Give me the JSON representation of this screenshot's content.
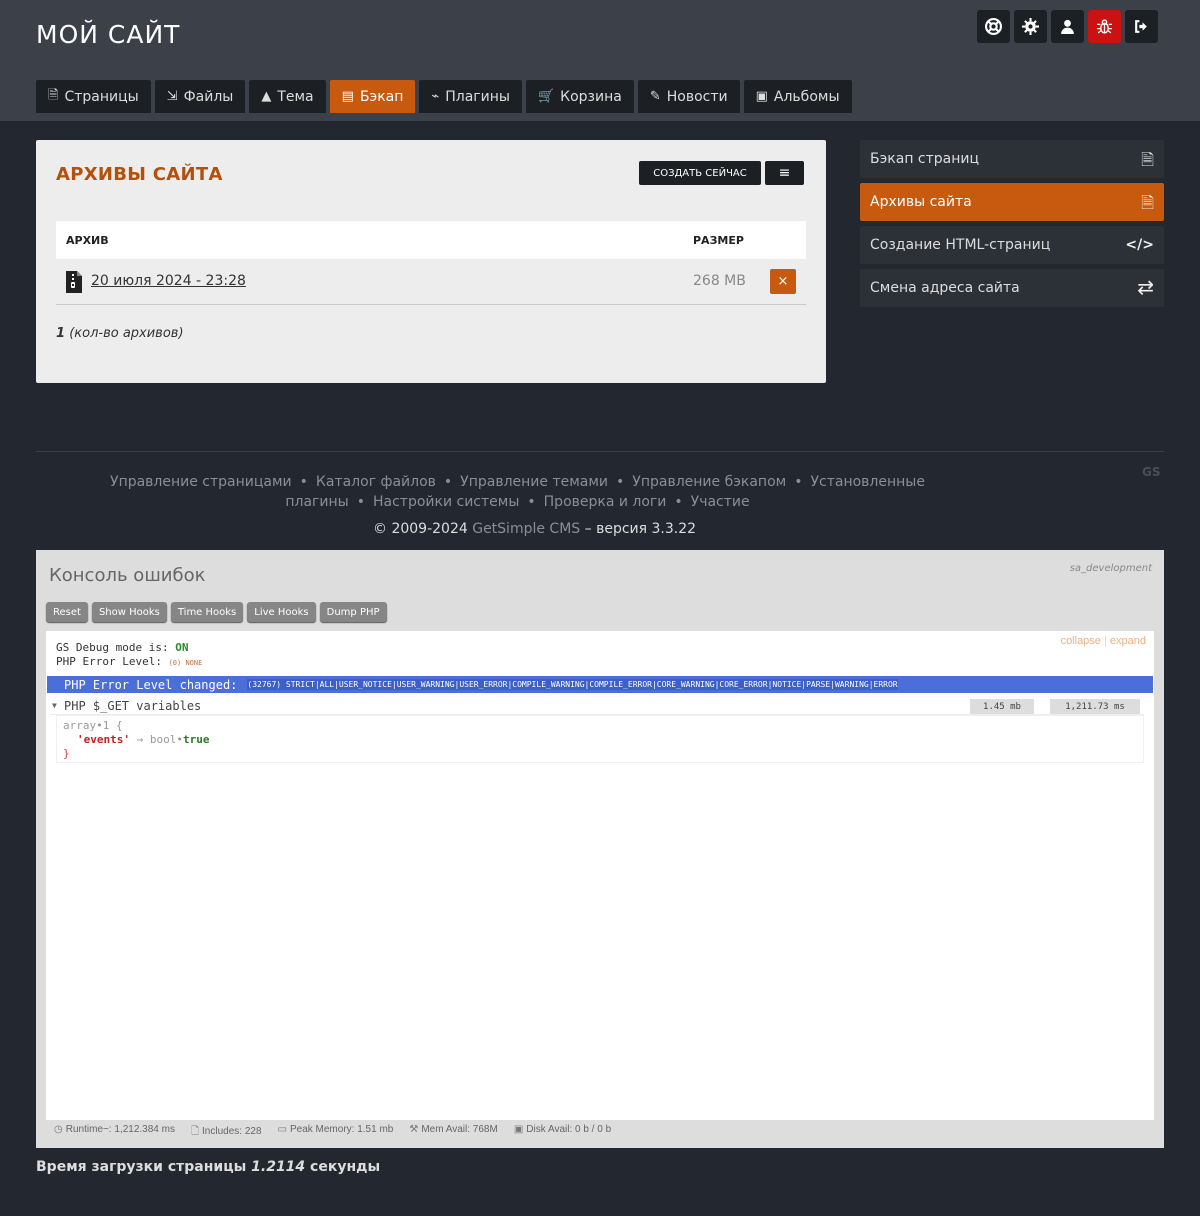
{
  "site": {
    "title": "МОЙ САЙТ"
  },
  "header_icons": [
    "lifebuoy-icon",
    "gear-icon",
    "user-icon",
    "bug-icon",
    "logout-icon"
  ],
  "tabs": [
    {
      "label": "Страницы",
      "icon": "file-icon"
    },
    {
      "label": "Файлы",
      "icon": "file-import-icon"
    },
    {
      "label": "Тема",
      "icon": "theme-icon"
    },
    {
      "label": "Бэкап",
      "icon": "hdd-icon",
      "active": true
    },
    {
      "label": "Плагины",
      "icon": "plug-icon"
    },
    {
      "label": "Корзина",
      "icon": "cart-icon"
    },
    {
      "label": "Новости",
      "icon": "edit-icon"
    },
    {
      "label": "Альбомы",
      "icon": "image-icon"
    }
  ],
  "main": {
    "title": "АРХИВЫ САЙТА",
    "create_label": "СОЗДАТЬ СЕЙЧАС",
    "menu_label": "≡",
    "col_archive": "АРХИВ",
    "col_size": "РАЗМЕР",
    "rows": [
      {
        "name": "20 июля 2024 - 23:28",
        "size": "268 MB",
        "delete": "×"
      }
    ],
    "count_num": "1",
    "count_label": "(кол-во архивов)"
  },
  "sidebar": {
    "items": [
      {
        "label": "Бэкап страниц",
        "icon": "file-text-icon",
        "glyph": "🗎"
      },
      {
        "label": "Архивы сайта",
        "icon": "file-archive-icon",
        "glyph": "🗎",
        "active": true
      },
      {
        "label": "Создание HTML-страниц",
        "icon": "code-icon",
        "glyph": "</>"
      },
      {
        "label": "Смена адреса сайта",
        "icon": "exchange-icon",
        "glyph": "⇄"
      }
    ]
  },
  "footer": {
    "links": [
      "Управление страницами",
      "Каталог файлов",
      "Управление темами",
      "Управление бэкапом",
      "Установленные плагины",
      "Настройки системы",
      "Проверка и логи",
      "Участие"
    ],
    "gs": "GS",
    "copyright_prefix": "© 2009-2024",
    "cms_name": "GetSimple CMS",
    "version": "– версия 3.3.22"
  },
  "console": {
    "title": "Консоль ошибок",
    "tag": "sa_development",
    "buttons": [
      "Reset",
      "Show Hooks",
      "Time Hooks",
      "Live Hooks",
      "Dump PHP"
    ],
    "collapse": "collapse",
    "expand": "expand",
    "debug_mode_label": "GS Debug mode is:",
    "debug_mode_value": "ON",
    "error_level_label": "PHP Error Level:",
    "error_level_value": "(0) NONE",
    "error_changed_label": "PHP Error Level changed:",
    "error_changed_value": "(32767) STRICT|ALL|USER_NOTICE|USER_WARNING|USER_ERROR|COMPILE_WARNING|COMPILE_ERROR|CORE_WARNING|CORE_ERROR|NOTICE|PARSE|WARNING|ERROR",
    "get_label": "PHP $_GET variables",
    "get_mem": "1.45 mb",
    "get_time": "1,211.73 ms",
    "array_head": "array•1 {",
    "array_key": "'events'",
    "array_arrow": "→ bool•",
    "array_val": "true",
    "array_close": "}",
    "stats": {
      "runtime": "Runtime~: 1,212.384 ms",
      "includes": "Includes: 228",
      "peak": "Peak Memory: 1.51 mb",
      "mem_avail": "Mem Avail: 768M",
      "disk_avail": "Disk Avail: 0 b / 0 b"
    }
  },
  "load_time": {
    "prefix": "Время загрузки страницы",
    "value": "1.2114",
    "suffix": "секунды"
  }
}
